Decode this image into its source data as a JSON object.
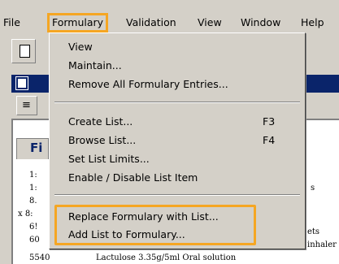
{
  "menubar": {
    "items": [
      {
        "label": "File"
      },
      {
        "label": "Formulary"
      },
      {
        "label": "Validation"
      },
      {
        "label": "View"
      },
      {
        "label": "Window"
      },
      {
        "label": "Help"
      }
    ]
  },
  "formulary_menu": {
    "items": [
      {
        "label": "View",
        "shortcut": ""
      },
      {
        "label": "Maintain...",
        "shortcut": ""
      },
      {
        "label": "Remove All Formulary Entries...",
        "shortcut": ""
      },
      {
        "label": "Create List...",
        "shortcut": "F3"
      },
      {
        "label": "Browse List...",
        "shortcut": "F4"
      },
      {
        "label": "Set List Limits...",
        "shortcut": ""
      },
      {
        "label": "Enable / Disable List Item",
        "shortcut": ""
      },
      {
        "label": "Replace Formulary with List...",
        "shortcut": ""
      },
      {
        "label": "Add List to Formulary...",
        "shortcut": ""
      }
    ]
  },
  "background": {
    "panel_tab_label": "Fi",
    "row_fragments": [
      "1:",
      "1:",
      "8.",
      "x  8:",
      "6!",
      "60",
      "5540"
    ],
    "right_fragments": [
      "s",
      "ets",
      "inhaler"
    ],
    "last_row_text": "Lactulose 3.35g/5ml Oral solution"
  },
  "colors": {
    "menu_background": "#d4d0c8",
    "highlight_outline": "#f5a623",
    "title_bar": "#0a246a"
  }
}
